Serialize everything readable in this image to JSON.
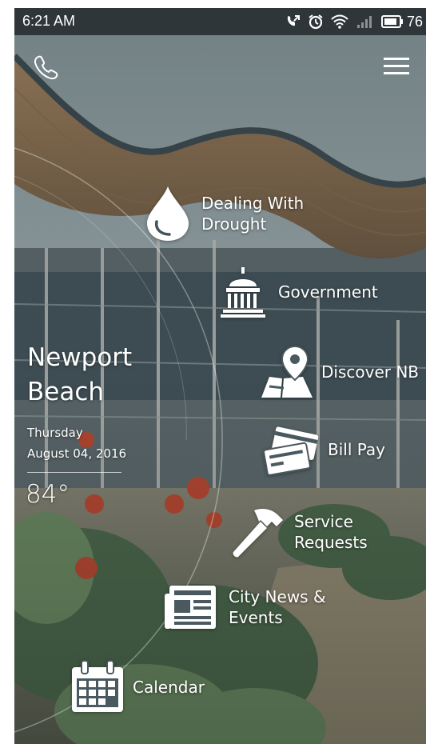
{
  "status_bar": {
    "time": "6:21 AM",
    "battery_level": "76",
    "icons": [
      "call-forward-icon",
      "alarm-icon",
      "wifi-icon",
      "signal-icon",
      "battery-icon"
    ]
  },
  "header": {
    "phone_icon": "phone-icon",
    "menu_icon": "hamburger-menu-icon"
  },
  "city": {
    "name_line1": "Newport",
    "name_line2": "Beach"
  },
  "date": {
    "day": "Thursday",
    "full_date": "August 04, 2016"
  },
  "weather": {
    "temperature": "84°"
  },
  "menu": {
    "items": [
      {
        "label": "Dealing With\nDrought",
        "icon": "water-drop-icon"
      },
      {
        "label": "Government",
        "icon": "capitol-building-icon"
      },
      {
        "label": "Discover NB",
        "icon": "map-pin-icon"
      },
      {
        "label": "Bill Pay",
        "icon": "credit-cards-icon"
      },
      {
        "label": "Service\nRequests",
        "icon": "hammer-icon"
      },
      {
        "label": "City News &\nEvents",
        "icon": "newspaper-icon"
      },
      {
        "label": "Calendar",
        "icon": "calendar-icon"
      }
    ]
  },
  "colors": {
    "status_bar": "#283034",
    "text": "#ffffff"
  }
}
